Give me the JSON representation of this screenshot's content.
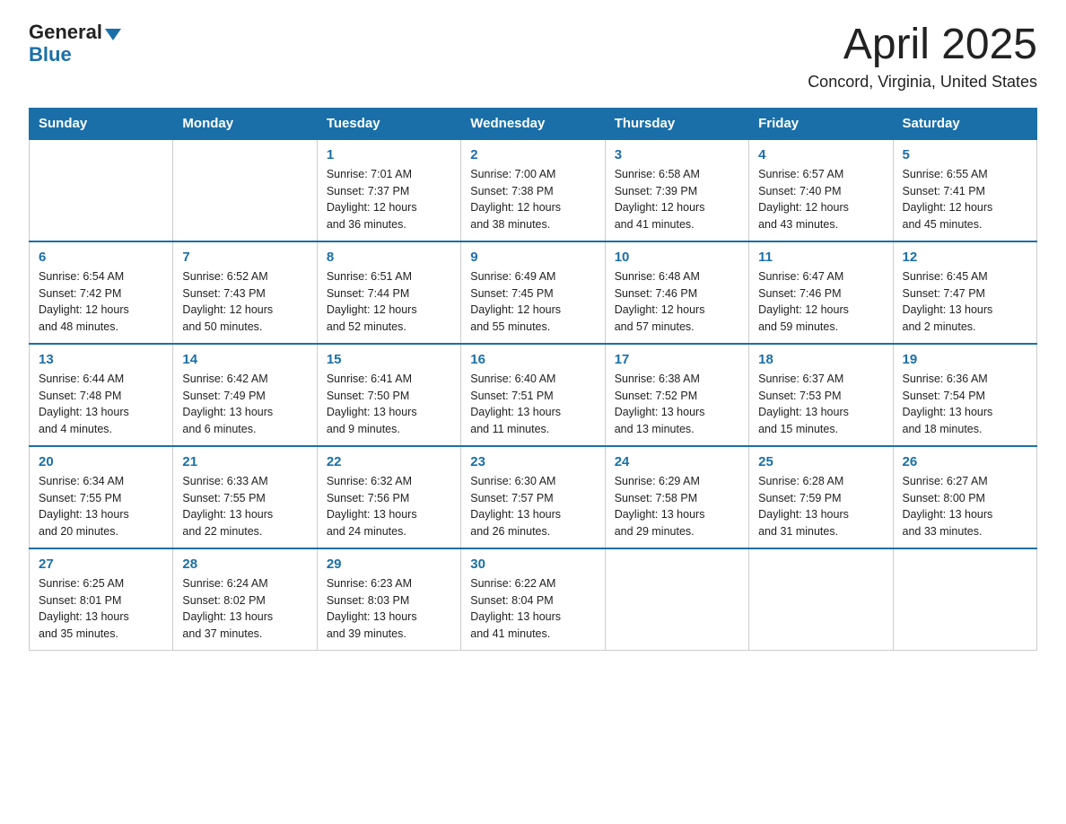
{
  "header": {
    "logo_line1": "General",
    "logo_line2": "Blue",
    "title": "April 2025",
    "subtitle": "Concord, Virginia, United States"
  },
  "days_of_week": [
    "Sunday",
    "Monday",
    "Tuesday",
    "Wednesday",
    "Thursday",
    "Friday",
    "Saturday"
  ],
  "weeks": [
    [
      {
        "day": "",
        "info": ""
      },
      {
        "day": "",
        "info": ""
      },
      {
        "day": "1",
        "info": "Sunrise: 7:01 AM\nSunset: 7:37 PM\nDaylight: 12 hours\nand 36 minutes."
      },
      {
        "day": "2",
        "info": "Sunrise: 7:00 AM\nSunset: 7:38 PM\nDaylight: 12 hours\nand 38 minutes."
      },
      {
        "day": "3",
        "info": "Sunrise: 6:58 AM\nSunset: 7:39 PM\nDaylight: 12 hours\nand 41 minutes."
      },
      {
        "day": "4",
        "info": "Sunrise: 6:57 AM\nSunset: 7:40 PM\nDaylight: 12 hours\nand 43 minutes."
      },
      {
        "day": "5",
        "info": "Sunrise: 6:55 AM\nSunset: 7:41 PM\nDaylight: 12 hours\nand 45 minutes."
      }
    ],
    [
      {
        "day": "6",
        "info": "Sunrise: 6:54 AM\nSunset: 7:42 PM\nDaylight: 12 hours\nand 48 minutes."
      },
      {
        "day": "7",
        "info": "Sunrise: 6:52 AM\nSunset: 7:43 PM\nDaylight: 12 hours\nand 50 minutes."
      },
      {
        "day": "8",
        "info": "Sunrise: 6:51 AM\nSunset: 7:44 PM\nDaylight: 12 hours\nand 52 minutes."
      },
      {
        "day": "9",
        "info": "Sunrise: 6:49 AM\nSunset: 7:45 PM\nDaylight: 12 hours\nand 55 minutes."
      },
      {
        "day": "10",
        "info": "Sunrise: 6:48 AM\nSunset: 7:46 PM\nDaylight: 12 hours\nand 57 minutes."
      },
      {
        "day": "11",
        "info": "Sunrise: 6:47 AM\nSunset: 7:46 PM\nDaylight: 12 hours\nand 59 minutes."
      },
      {
        "day": "12",
        "info": "Sunrise: 6:45 AM\nSunset: 7:47 PM\nDaylight: 13 hours\nand 2 minutes."
      }
    ],
    [
      {
        "day": "13",
        "info": "Sunrise: 6:44 AM\nSunset: 7:48 PM\nDaylight: 13 hours\nand 4 minutes."
      },
      {
        "day": "14",
        "info": "Sunrise: 6:42 AM\nSunset: 7:49 PM\nDaylight: 13 hours\nand 6 minutes."
      },
      {
        "day": "15",
        "info": "Sunrise: 6:41 AM\nSunset: 7:50 PM\nDaylight: 13 hours\nand 9 minutes."
      },
      {
        "day": "16",
        "info": "Sunrise: 6:40 AM\nSunset: 7:51 PM\nDaylight: 13 hours\nand 11 minutes."
      },
      {
        "day": "17",
        "info": "Sunrise: 6:38 AM\nSunset: 7:52 PM\nDaylight: 13 hours\nand 13 minutes."
      },
      {
        "day": "18",
        "info": "Sunrise: 6:37 AM\nSunset: 7:53 PM\nDaylight: 13 hours\nand 15 minutes."
      },
      {
        "day": "19",
        "info": "Sunrise: 6:36 AM\nSunset: 7:54 PM\nDaylight: 13 hours\nand 18 minutes."
      }
    ],
    [
      {
        "day": "20",
        "info": "Sunrise: 6:34 AM\nSunset: 7:55 PM\nDaylight: 13 hours\nand 20 minutes."
      },
      {
        "day": "21",
        "info": "Sunrise: 6:33 AM\nSunset: 7:55 PM\nDaylight: 13 hours\nand 22 minutes."
      },
      {
        "day": "22",
        "info": "Sunrise: 6:32 AM\nSunset: 7:56 PM\nDaylight: 13 hours\nand 24 minutes."
      },
      {
        "day": "23",
        "info": "Sunrise: 6:30 AM\nSunset: 7:57 PM\nDaylight: 13 hours\nand 26 minutes."
      },
      {
        "day": "24",
        "info": "Sunrise: 6:29 AM\nSunset: 7:58 PM\nDaylight: 13 hours\nand 29 minutes."
      },
      {
        "day": "25",
        "info": "Sunrise: 6:28 AM\nSunset: 7:59 PM\nDaylight: 13 hours\nand 31 minutes."
      },
      {
        "day": "26",
        "info": "Sunrise: 6:27 AM\nSunset: 8:00 PM\nDaylight: 13 hours\nand 33 minutes."
      }
    ],
    [
      {
        "day": "27",
        "info": "Sunrise: 6:25 AM\nSunset: 8:01 PM\nDaylight: 13 hours\nand 35 minutes."
      },
      {
        "day": "28",
        "info": "Sunrise: 6:24 AM\nSunset: 8:02 PM\nDaylight: 13 hours\nand 37 minutes."
      },
      {
        "day": "29",
        "info": "Sunrise: 6:23 AM\nSunset: 8:03 PM\nDaylight: 13 hours\nand 39 minutes."
      },
      {
        "day": "30",
        "info": "Sunrise: 6:22 AM\nSunset: 8:04 PM\nDaylight: 13 hours\nand 41 minutes."
      },
      {
        "day": "",
        "info": ""
      },
      {
        "day": "",
        "info": ""
      },
      {
        "day": "",
        "info": ""
      }
    ]
  ]
}
